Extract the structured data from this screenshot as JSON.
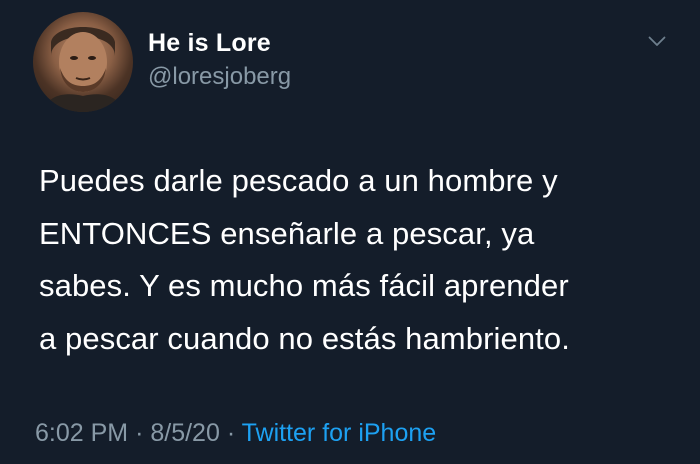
{
  "tweet": {
    "author": {
      "display_name": "He is Lore",
      "handle": "@loresjoberg",
      "avatar": "avatar-photo"
    },
    "menu_icon": "chevron-down-icon",
    "text": "Puedes darle pescado a un hombre y\nENTONCES enseñarle a pescar, ya\nsabes. Y es mucho más fácil aprender\na pescar cuando no estás hambriento.",
    "time": "6:02 PM",
    "separator": "·",
    "date": "8/5/20",
    "source": "Twitter for iPhone"
  },
  "colors": {
    "background": "#141d2a",
    "text": "#ffffff",
    "secondary_text": "#8899a6",
    "link": "#1da1f2"
  }
}
